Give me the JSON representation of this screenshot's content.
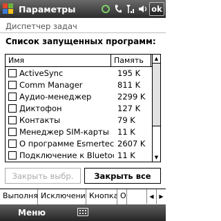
{
  "titlebar": {
    "title": "Параметры",
    "ok_label": "ok"
  },
  "subtitle": "Диспетчер задач",
  "section_label": "Список запущенных программ:",
  "list": {
    "columns": [
      "Имя",
      "Память"
    ],
    "rows": [
      {
        "name": "ActiveSync",
        "memory": "195 K"
      },
      {
        "name": "Comm Manager",
        "memory": "811 K"
      },
      {
        "name": "Аудио-менеджер",
        "memory": "2299 K"
      },
      {
        "name": "Диктофон",
        "memory": "127 K"
      },
      {
        "name": "Контакты",
        "memory": "79 K"
      },
      {
        "name": "Менеджер SIM-карты",
        "memory": "11 K"
      },
      {
        "name": "О программе Esmertec Jbed",
        "memory": "2607 K"
      },
      {
        "name": "Подключение к Bluetooth",
        "memory": "11 K"
      }
    ]
  },
  "buttons": {
    "close_selected": "Закрыть выбр.",
    "close_all": "Закрыть все"
  },
  "tabs": [
    "Выполнятся",
    "Исключения",
    "Кнопка",
    "Опции"
  ],
  "softbar": {
    "menu": "Меню"
  },
  "icons": [
    "windows-start-icon",
    "sync-icon",
    "phone-icon",
    "signal-icon",
    "speaker-icon",
    "keyboard-icon"
  ]
}
